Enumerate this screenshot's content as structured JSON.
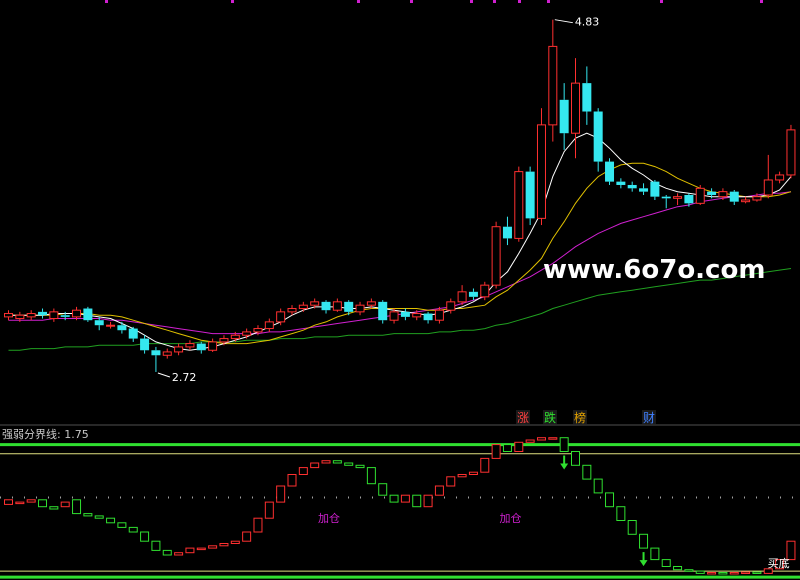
{
  "chart_data": [
    {
      "type": "candlestick",
      "high_label": "4.83",
      "low_label": "2.72",
      "watermark": "www.6o7o.com",
      "event_marks": [
        "涨",
        "跌",
        "榜",
        "财"
      ],
      "y_range": [
        2.6,
        4.9
      ],
      "colors": {
        "up": "#ff3030",
        "down": "#35e8f0",
        "ma5": "#ffffff",
        "ma10": "#e0c000",
        "ma20": "#d020d0",
        "ma60": "#20a020",
        "watermark": "#ffffff"
      },
      "candles": [
        [
          3.05,
          3.07,
          3.09,
          3.03
        ],
        [
          3.04,
          3.06,
          3.08,
          3.02
        ],
        [
          3.05,
          3.07,
          3.09,
          3.03
        ],
        [
          3.08,
          3.06,
          3.1,
          3.04
        ],
        [
          3.04,
          3.08,
          3.1,
          3.02
        ],
        [
          3.06,
          3.05,
          3.08,
          3.03
        ],
        [
          3.05,
          3.09,
          3.11,
          3.03
        ],
        [
          3.1,
          3.03,
          3.11,
          3.02
        ],
        [
          3.03,
          3.0,
          3.05,
          2.97
        ],
        [
          3.0,
          3.0,
          3.02,
          2.98
        ],
        [
          3.0,
          2.97,
          3.02,
          2.95
        ],
        [
          2.98,
          2.92,
          2.99,
          2.9
        ],
        [
          2.92,
          2.85,
          2.94,
          2.83
        ],
        [
          2.85,
          2.82,
          2.87,
          2.72
        ],
        [
          2.82,
          2.84,
          2.86,
          2.8
        ],
        [
          2.84,
          2.87,
          2.89,
          2.82
        ],
        [
          2.87,
          2.89,
          2.91,
          2.85
        ],
        [
          2.89,
          2.85,
          2.9,
          2.83
        ],
        [
          2.85,
          2.9,
          2.92,
          2.84
        ],
        [
          2.9,
          2.92,
          2.94,
          2.88
        ],
        [
          2.92,
          2.94,
          2.96,
          2.9
        ],
        [
          2.94,
          2.96,
          2.98,
          2.92
        ],
        [
          2.96,
          2.98,
          3.0,
          2.94
        ],
        [
          2.98,
          3.02,
          3.04,
          2.96
        ],
        [
          3.02,
          3.08,
          3.1,
          3.0
        ],
        [
          3.08,
          3.1,
          3.12,
          3.06
        ],
        [
          3.1,
          3.12,
          3.14,
          3.08
        ],
        [
          3.12,
          3.14,
          3.16,
          3.1
        ],
        [
          3.14,
          3.09,
          3.15,
          3.07
        ],
        [
          3.09,
          3.14,
          3.16,
          3.08
        ],
        [
          3.14,
          3.08,
          3.15,
          3.06
        ],
        [
          3.08,
          3.12,
          3.14,
          3.06
        ],
        [
          3.12,
          3.14,
          3.16,
          3.1
        ],
        [
          3.14,
          3.03,
          3.15,
          3.01
        ],
        [
          3.03,
          3.08,
          3.1,
          3.01
        ],
        [
          3.08,
          3.05,
          3.1,
          3.03
        ],
        [
          3.05,
          3.07,
          3.09,
          3.03
        ],
        [
          3.07,
          3.03,
          3.08,
          3.01
        ],
        [
          3.03,
          3.09,
          3.11,
          3.01
        ],
        [
          3.09,
          3.14,
          3.16,
          3.07
        ],
        [
          3.14,
          3.2,
          3.24,
          3.12
        ],
        [
          3.2,
          3.17,
          3.22,
          3.15
        ],
        [
          3.17,
          3.24,
          3.26,
          3.15
        ],
        [
          3.24,
          3.59,
          3.62,
          3.22
        ],
        [
          3.59,
          3.52,
          3.65,
          3.48
        ],
        [
          3.52,
          3.92,
          3.95,
          3.5
        ],
        [
          3.92,
          3.64,
          3.95,
          3.6
        ],
        [
          3.64,
          4.2,
          4.3,
          3.6
        ],
        [
          4.2,
          4.67,
          4.83,
          4.1
        ],
        [
          4.35,
          4.15,
          4.45,
          4.05
        ],
        [
          4.15,
          4.45,
          4.6,
          4.0
        ],
        [
          4.45,
          4.28,
          4.55,
          4.2
        ],
        [
          4.28,
          3.98,
          4.3,
          3.92
        ],
        [
          3.98,
          3.86,
          4.0,
          3.84
        ],
        [
          3.86,
          3.84,
          3.88,
          3.82
        ],
        [
          3.84,
          3.82,
          3.86,
          3.8
        ],
        [
          3.82,
          3.8,
          3.85,
          3.78
        ],
        [
          3.86,
          3.77,
          3.87,
          3.75
        ],
        [
          3.77,
          3.76,
          3.78,
          3.7
        ],
        [
          3.76,
          3.77,
          3.79,
          3.72
        ],
        [
          3.78,
          3.73,
          3.79,
          3.71
        ],
        [
          3.73,
          3.82,
          3.84,
          3.72
        ],
        [
          3.8,
          3.78,
          3.82,
          3.76
        ],
        [
          3.77,
          3.8,
          3.82,
          3.75
        ],
        [
          3.8,
          3.74,
          3.81,
          3.72
        ],
        [
          3.74,
          3.75,
          3.77,
          3.73
        ],
        [
          3.75,
          3.77,
          3.79,
          3.74
        ],
        [
          3.78,
          3.87,
          4.02,
          3.76
        ],
        [
          3.87,
          3.9,
          3.92,
          3.85
        ],
        [
          3.9,
          4.17,
          4.2,
          3.88
        ]
      ],
      "ma": {
        "ma5": [
          3.06,
          3.06,
          3.06,
          3.06,
          3.07,
          3.07,
          3.07,
          3.06,
          3.05,
          3.04,
          3.01,
          2.98,
          2.94,
          2.9,
          2.88,
          2.86,
          2.85,
          2.86,
          2.87,
          2.89,
          2.91,
          2.93,
          2.96,
          2.99,
          3.02,
          3.06,
          3.09,
          3.11,
          3.11,
          3.11,
          3.1,
          3.1,
          3.11,
          3.1,
          3.09,
          3.08,
          3.07,
          3.06,
          3.07,
          3.09,
          3.11,
          3.14,
          3.18,
          3.26,
          3.32,
          3.43,
          3.55,
          3.68,
          3.89,
          4.04,
          4.12,
          4.15,
          4.12,
          4.06,
          3.99,
          3.94,
          3.9,
          3.85,
          3.82,
          3.8,
          3.79,
          3.78,
          3.77,
          3.77,
          3.77,
          3.77,
          3.77,
          3.78,
          3.81,
          3.89
        ],
        "ma10": [
          3.06,
          3.06,
          3.06,
          3.06,
          3.06,
          3.07,
          3.07,
          3.07,
          3.06,
          3.06,
          3.05,
          3.03,
          3.01,
          2.99,
          2.97,
          2.95,
          2.93,
          2.91,
          2.9,
          2.89,
          2.89,
          2.89,
          2.9,
          2.91,
          2.93,
          2.95,
          2.97,
          3.0,
          3.02,
          3.05,
          3.07,
          3.09,
          3.1,
          3.1,
          3.1,
          3.1,
          3.1,
          3.09,
          3.09,
          3.1,
          3.1,
          3.11,
          3.12,
          3.17,
          3.21,
          3.27,
          3.33,
          3.4,
          3.52,
          3.62,
          3.73,
          3.82,
          3.89,
          3.93,
          3.96,
          3.97,
          3.97,
          3.95,
          3.92,
          3.88,
          3.85,
          3.82,
          3.8,
          3.79,
          3.78,
          3.77,
          3.77,
          3.77,
          3.78,
          3.8
        ],
        "ma20": [
          3.03,
          3.03,
          3.03,
          3.03,
          3.04,
          3.04,
          3.04,
          3.04,
          3.04,
          3.03,
          3.03,
          3.02,
          3.01,
          3.0,
          2.99,
          2.98,
          2.97,
          2.96,
          2.95,
          2.95,
          2.95,
          2.95,
          2.95,
          2.96,
          2.96,
          2.97,
          2.98,
          2.99,
          3.0,
          3.01,
          3.02,
          3.03,
          3.04,
          3.05,
          3.06,
          3.07,
          3.08,
          3.09,
          3.1,
          3.11,
          3.13,
          3.15,
          3.17,
          3.2,
          3.23,
          3.26,
          3.29,
          3.33,
          3.37,
          3.42,
          3.47,
          3.51,
          3.55,
          3.58,
          3.61,
          3.63,
          3.65,
          3.67,
          3.69,
          3.71,
          3.72,
          3.74,
          3.75,
          3.76,
          3.77,
          3.77,
          3.78,
          3.79,
          3.79,
          3.8
        ],
        "ma60": [
          2.85,
          2.85,
          2.86,
          2.86,
          2.86,
          2.87,
          2.87,
          2.87,
          2.88,
          2.88,
          2.88,
          2.88,
          2.89,
          2.89,
          2.89,
          2.89,
          2.89,
          2.9,
          2.9,
          2.9,
          2.9,
          2.91,
          2.91,
          2.91,
          2.92,
          2.92,
          2.92,
          2.93,
          2.93,
          2.93,
          2.94,
          2.94,
          2.94,
          2.94,
          2.95,
          2.95,
          2.95,
          2.95,
          2.96,
          2.96,
          2.97,
          2.97,
          2.98,
          3.0,
          3.01,
          3.03,
          3.05,
          3.07,
          3.1,
          3.12,
          3.14,
          3.16,
          3.18,
          3.19,
          3.2,
          3.21,
          3.22,
          3.23,
          3.24,
          3.25,
          3.26,
          3.27,
          3.27,
          3.28,
          3.29,
          3.3,
          3.31,
          3.32,
          3.33,
          3.34
        ]
      }
    },
    {
      "type": "indicator",
      "title": "强弱分界线: 1.75",
      "annotations": [
        "加仓",
        "加仓",
        "买底"
      ],
      "y_range": [
        0,
        3.0
      ],
      "levels": [
        {
          "value": 2.9,
          "color": "#30e030"
        },
        {
          "value": 2.7,
          "color": "#e0e080"
        },
        {
          "value": 1.75,
          "color": "#a0a0a0"
        },
        {
          "value": 0.15,
          "color": "#e0e080"
        },
        {
          "value": 0.02,
          "color": "#30e030"
        }
      ],
      "colors": {
        "up": "#ff3030",
        "down": "#30e030",
        "arrow": "#30e030",
        "annotation": "#d020d0",
        "title": "#c8c8c8"
      },
      "bars": [
        [
          1.6,
          1.7
        ],
        [
          1.65,
          1.65
        ],
        [
          1.65,
          1.7
        ],
        [
          1.7,
          1.55
        ],
        [
          1.55,
          1.5
        ],
        [
          1.55,
          1.65
        ],
        [
          1.7,
          1.4
        ],
        [
          1.4,
          1.35
        ],
        [
          1.35,
          1.3
        ],
        [
          1.3,
          1.2
        ],
        [
          1.2,
          1.1
        ],
        [
          1.1,
          1.0
        ],
        [
          1.0,
          0.8
        ],
        [
          0.8,
          0.6
        ],
        [
          0.6,
          0.5
        ],
        [
          0.5,
          0.55
        ],
        [
          0.55,
          0.65
        ],
        [
          0.65,
          0.65
        ],
        [
          0.65,
          0.7
        ],
        [
          0.7,
          0.75
        ],
        [
          0.75,
          0.8
        ],
        [
          0.8,
          1.0
        ],
        [
          1.0,
          1.3
        ],
        [
          1.3,
          1.65
        ],
        [
          1.65,
          2.0
        ],
        [
          2.0,
          2.25
        ],
        [
          2.25,
          2.4
        ],
        [
          2.4,
          2.5
        ],
        [
          2.5,
          2.55
        ],
        [
          2.55,
          2.5
        ],
        [
          2.5,
          2.45
        ],
        [
          2.45,
          2.4
        ],
        [
          2.4,
          2.05
        ],
        [
          2.05,
          1.8
        ],
        [
          1.8,
          1.65
        ],
        [
          1.65,
          1.8
        ],
        [
          1.8,
          1.55
        ],
        [
          1.55,
          1.8
        ],
        [
          1.8,
          2.0
        ],
        [
          2.0,
          2.2
        ],
        [
          2.2,
          2.25
        ],
        [
          2.25,
          2.3
        ],
        [
          2.3,
          2.6
        ],
        [
          2.6,
          2.9
        ],
        [
          2.9,
          2.75
        ],
        [
          2.75,
          2.95
        ],
        [
          2.95,
          3.0
        ],
        [
          3.0,
          3.05
        ],
        [
          3.05,
          3.05
        ],
        [
          3.05,
          2.75
        ],
        [
          2.75,
          2.45
        ],
        [
          2.45,
          2.15
        ],
        [
          2.15,
          1.85
        ],
        [
          1.85,
          1.55
        ],
        [
          1.55,
          1.25
        ],
        [
          1.25,
          0.95
        ],
        [
          0.95,
          0.65
        ],
        [
          0.65,
          0.4
        ],
        [
          0.4,
          0.25
        ],
        [
          0.25,
          0.18
        ],
        [
          0.18,
          0.15
        ],
        [
          0.15,
          0.1
        ],
        [
          0.1,
          0.12
        ],
        [
          0.12,
          0.1
        ],
        [
          0.1,
          0.12
        ],
        [
          0.12,
          0.13
        ],
        [
          0.13,
          0.1
        ],
        [
          0.1,
          0.2
        ],
        [
          0.2,
          0.4
        ],
        [
          0.4,
          0.8
        ]
      ],
      "arrows_down_at": [
        49,
        56
      ],
      "annotation_index": [
        28,
        44,
        68
      ]
    }
  ]
}
